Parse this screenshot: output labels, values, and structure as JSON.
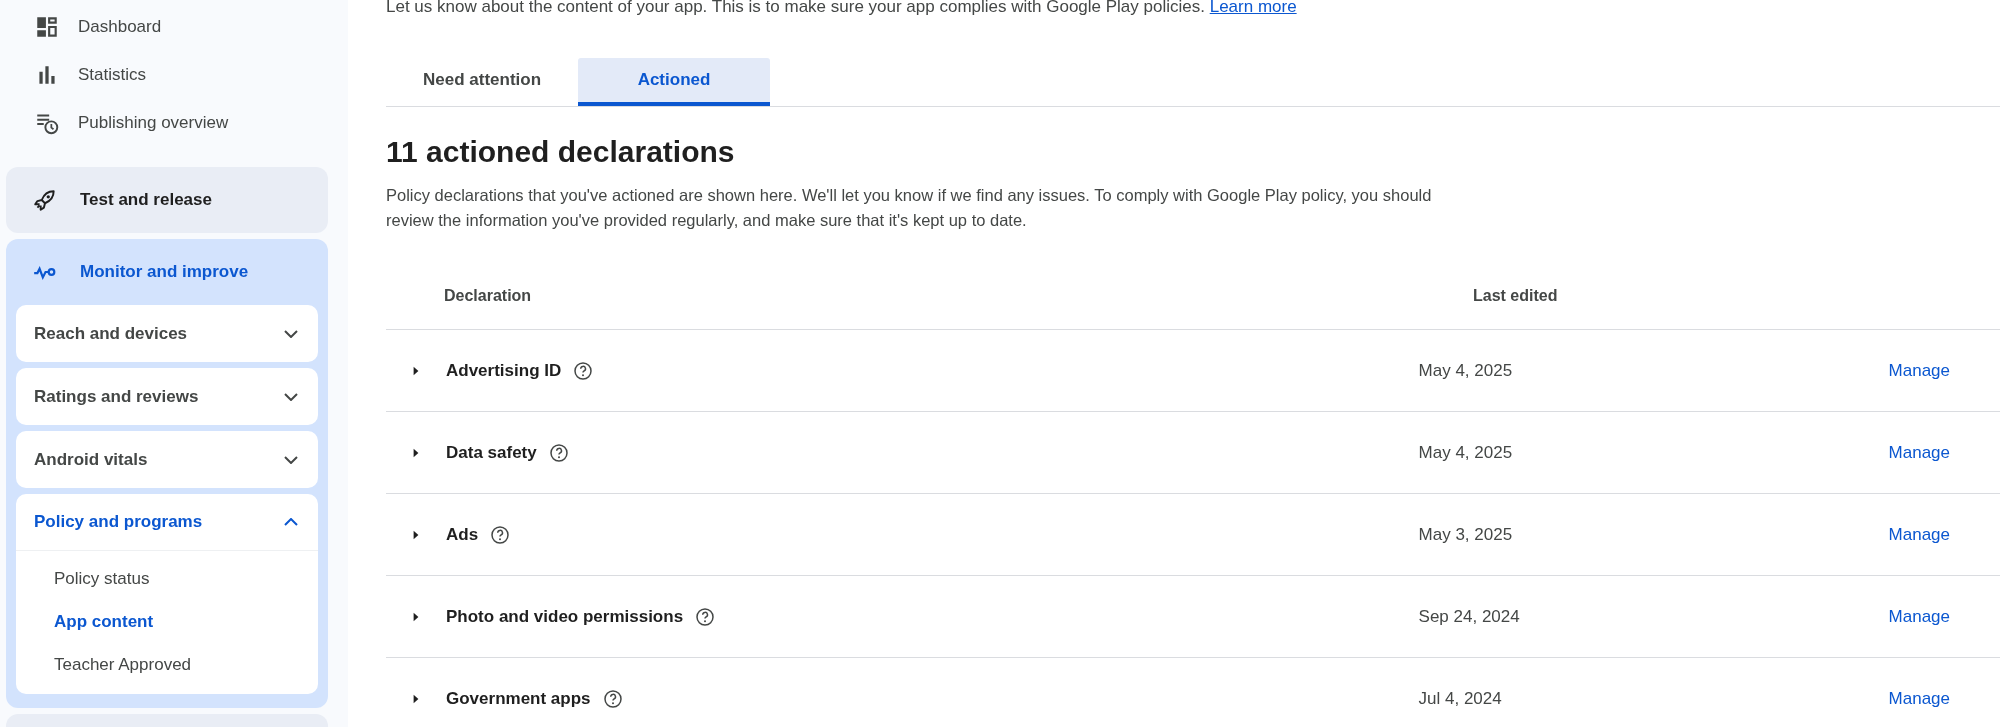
{
  "sidebar": {
    "items": [
      {
        "label": "Dashboard",
        "kind": "dashboard"
      },
      {
        "label": "Statistics",
        "kind": "bars"
      },
      {
        "label": "Publishing overview",
        "kind": "clock-list"
      }
    ],
    "sections": [
      {
        "label": "Test and release",
        "kind": "rocket",
        "selected": false
      },
      {
        "label": "Monitor and improve",
        "kind": "pulse",
        "selected": true,
        "groups": [
          {
            "label": "Reach and devices",
            "expanded": false,
            "selected": false
          },
          {
            "label": "Ratings and reviews",
            "expanded": false,
            "selected": false
          },
          {
            "label": "Android vitals",
            "expanded": false,
            "selected": false
          },
          {
            "label": "Policy and programs",
            "expanded": true,
            "selected": true,
            "children": [
              {
                "label": "Policy status",
                "selected": false
              },
              {
                "label": "App content",
                "selected": true
              },
              {
                "label": "Teacher Approved",
                "selected": false
              }
            ]
          }
        ]
      }
    ]
  },
  "intro": {
    "text": "Let us know about the content of your app. This is to make sure your app complies with Google Play policies.",
    "link": "Learn more"
  },
  "tabs": [
    {
      "label": "Need attention",
      "selected": false
    },
    {
      "label": "Actioned",
      "selected": true
    }
  ],
  "heading": "11 actioned declarations",
  "description": "Policy declarations that you've actioned are shown here. We'll let you know if we find any issues. To comply with Google Play policy, you should review the information you've provided regularly, and make sure that it's kept up to date.",
  "table": {
    "columns": [
      "Declaration",
      "Last edited"
    ],
    "rows": [
      {
        "name": "Advertising ID",
        "date": "May 4, 2025",
        "action": "Manage",
        "expanded": false
      },
      {
        "name": "Data safety",
        "date": "May 4, 2025",
        "action": "Manage",
        "expanded": false
      },
      {
        "name": "Ads",
        "date": "May 3, 2025",
        "action": "Manage",
        "expanded": false
      },
      {
        "name": "Photo and video permissions",
        "date": "Sep 24, 2024",
        "action": "Manage",
        "expanded": false
      },
      {
        "name": "Government apps",
        "date": "Jul 4, 2024",
        "action": "Manage",
        "expanded": false
      }
    ]
  }
}
